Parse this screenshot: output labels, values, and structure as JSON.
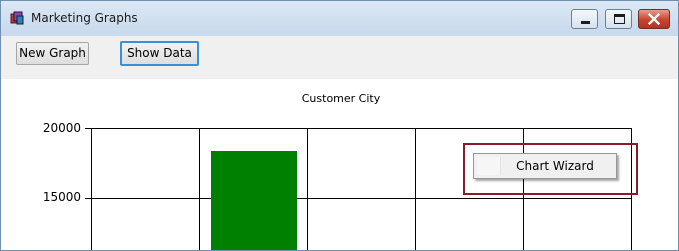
{
  "window": {
    "title": "Marketing Graphs"
  },
  "toolbar": {
    "new_graph_label": "New Graph",
    "show_data_label": "Show Data"
  },
  "context_menu": {
    "items": [
      {
        "label": "Chart Wizard"
      }
    ]
  },
  "colors": {
    "bar": "#008000",
    "highlight_border": "#8b1a2b",
    "focus_border": "#3b8fd6"
  },
  "chart_data": {
    "type": "bar",
    "title": "Customer City",
    "xlabel": "",
    "ylabel": "",
    "y_tick_labels": [
      "20000",
      "15000"
    ],
    "ylim_visible": [
      13500,
      20000
    ],
    "categories_visible": 5,
    "series": [
      {
        "values": [
          null,
          18400,
          null,
          null,
          null
        ]
      }
    ],
    "grid": true
  }
}
